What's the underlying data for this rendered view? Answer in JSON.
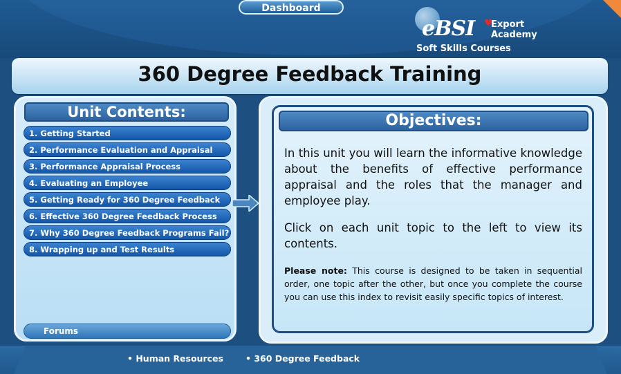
{
  "header": {
    "dashboard_label": "Dashboard",
    "logo": {
      "mark": "eBSI",
      "name_line1": "Export",
      "name_line2": "Academy",
      "subtitle": "Soft Skills Courses"
    }
  },
  "page": {
    "title": "360 Degree Feedback Training"
  },
  "sidebar": {
    "heading": "Unit Contents:",
    "items": [
      {
        "label": "1. Getting Started"
      },
      {
        "label": "2. Performance Evaluation and Appraisal"
      },
      {
        "label": "3. Performance Appraisal Process"
      },
      {
        "label": "4. Evaluating an Employee"
      },
      {
        "label": "5. Getting Ready for 360 Degree Feedback"
      },
      {
        "label": "6. Effective 360 Degree Feedback Process"
      },
      {
        "label": "7. Why 360 Degree Feedback Programs Fail?"
      },
      {
        "label": "8. Wrapping up and Test Results"
      }
    ],
    "forums_label": "Forums"
  },
  "objectives": {
    "heading": "Objectives:",
    "paragraph1": "In this unit you will learn the informative knowledge about the benefits of effective performance appraisal and the roles that the manager and employee play.",
    "paragraph2": "Click on each unit topic to the left to view its contents.",
    "note_label": "Please note:",
    "note_text": " This course is designed to be taken in sequential order, one topic after the other, but once you complete the course you can use this index to revisit easily specific topics of interest."
  },
  "footer": {
    "crumbs": [
      "• Human Resources",
      "• 360 Degree Feedback"
    ]
  },
  "colors": {
    "background": "#1d4f80",
    "menu_item": "#1356a8",
    "accent_orange": "#f08a3a"
  }
}
